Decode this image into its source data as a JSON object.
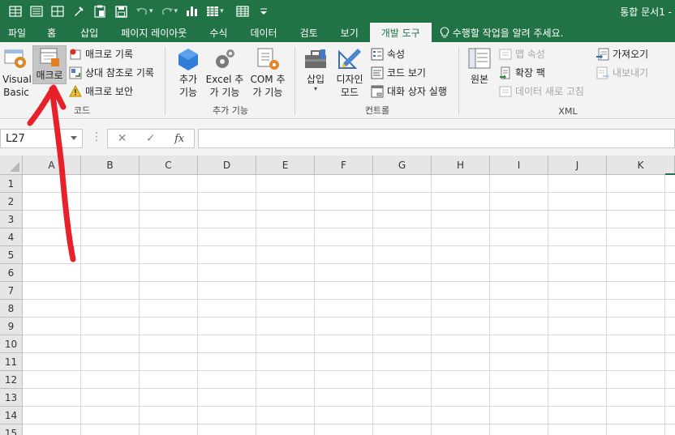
{
  "title_bar": {
    "app_title": "통합 문서1 -",
    "qat_icons": [
      "table-icon",
      "form-icon",
      "grid-icon",
      "pin-icon",
      "paste-icon",
      "save-icon",
      "undo-icon",
      "redo-icon",
      "chart-icon",
      "matrix-icon",
      "table2-icon",
      "customize-icon"
    ]
  },
  "tabs": [
    {
      "label": "파일"
    },
    {
      "label": "홈"
    },
    {
      "label": "삽입"
    },
    {
      "label": "페이지 레이아웃"
    },
    {
      "label": "수식"
    },
    {
      "label": "데이터"
    },
    {
      "label": "검토"
    },
    {
      "label": "보기"
    },
    {
      "label": "개발 도구"
    }
  ],
  "tellme": {
    "label": "수행할 작업을 알려 주세요."
  },
  "ribbon": {
    "code": {
      "label": "코드",
      "visual_basic": "Visual Basic",
      "macro": "매크로",
      "record_macro": "매크로 기록",
      "relative_ref": "상대 참조로 기록",
      "macro_security": "매크로 보안"
    },
    "addins": {
      "label": "추가 기능",
      "addins_btn": "추가 기능",
      "excel_addins": "Excel 추가 기능",
      "com_addins": "COM 추가 기능"
    },
    "controls": {
      "label": "컨트롤",
      "insert": "삽입",
      "design_mode": "디자인 모드",
      "properties": "속성",
      "view_code": "코드 보기",
      "run_dialog": "대화 상자 실행"
    },
    "xml": {
      "label": "XML",
      "source": "원본",
      "map_props": "맵 속성",
      "expansion_packs": "확장 팩",
      "refresh_data": "데이터 새로 고침",
      "import": "가져오기",
      "export": "내보내기"
    }
  },
  "formula_bar": {
    "name_box": "L27",
    "dots": "⋮",
    "cancel": "✕",
    "enter": "✓",
    "fx": "fx",
    "value": ""
  },
  "grid": {
    "columns": [
      "A",
      "B",
      "C",
      "D",
      "E",
      "F",
      "G",
      "H",
      "I",
      "J",
      "K"
    ],
    "rows": [
      "1",
      "2",
      "3",
      "4",
      "5",
      "6",
      "7",
      "8",
      "9",
      "10",
      "11",
      "12",
      "13",
      "14",
      "15"
    ]
  },
  "colors": {
    "accent": "#217346",
    "annotation": "#e8202a"
  }
}
